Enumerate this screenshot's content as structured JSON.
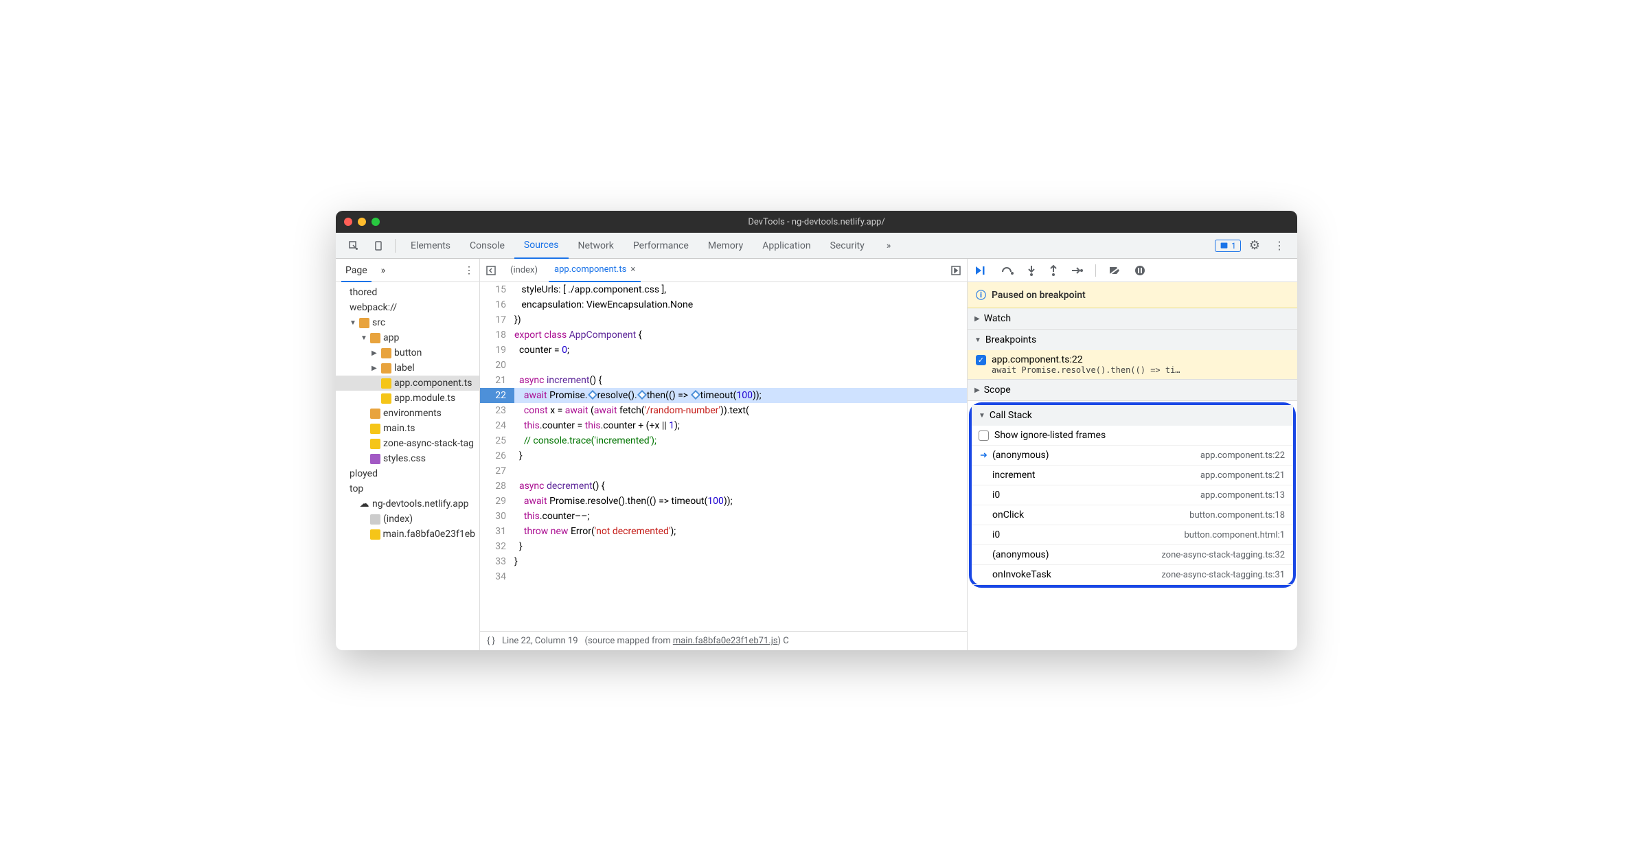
{
  "title": "DevTools - ng-devtools.netlify.app/",
  "topTabs": [
    "Elements",
    "Console",
    "Sources",
    "Network",
    "Performance",
    "Memory",
    "Application",
    "Security"
  ],
  "topTabActive": "Sources",
  "overflowChevrons": "»",
  "issueCount": "1",
  "navTab": "Page",
  "tree": [
    {
      "label": "thored",
      "indent": 0,
      "kind": "plain"
    },
    {
      "label": "webpack://",
      "indent": 0,
      "kind": "plain"
    },
    {
      "label": "src",
      "indent": 1,
      "kind": "folder",
      "open": true
    },
    {
      "label": "app",
      "indent": 2,
      "kind": "folder",
      "open": true
    },
    {
      "label": "button",
      "indent": 3,
      "kind": "folder",
      "arrow": true
    },
    {
      "label": "label",
      "indent": 3,
      "kind": "folder",
      "arrow": true
    },
    {
      "label": "app.component.ts",
      "indent": 4,
      "kind": "file-y",
      "sel": true
    },
    {
      "label": "app.module.ts",
      "indent": 4,
      "kind": "file-y"
    },
    {
      "label": "environments",
      "indent": 2,
      "kind": "folder"
    },
    {
      "label": "main.ts",
      "indent": 2,
      "kind": "file-y"
    },
    {
      "label": "zone-async-stack-tag",
      "indent": 2,
      "kind": "file-y"
    },
    {
      "label": "styles.css",
      "indent": 2,
      "kind": "file-p"
    },
    {
      "label": "ployed",
      "indent": 0,
      "kind": "plain"
    },
    {
      "label": "top",
      "indent": 0,
      "kind": "plain"
    },
    {
      "label": "ng-devtools.netlify.app",
      "indent": 1,
      "kind": "cloud"
    },
    {
      "label": "(index)",
      "indent": 2,
      "kind": "file-g"
    },
    {
      "label": "main.fa8bfa0e23f1eb",
      "indent": 2,
      "kind": "file-y"
    }
  ],
  "editorTabs": [
    {
      "label": "(index)",
      "active": false
    },
    {
      "label": "app.component.ts",
      "active": true
    }
  ],
  "code": {
    "start": 15,
    "lines": [
      "   styleUrls: [ ./app.component.css ],",
      "   encapsulation: ViewEncapsulation.None",
      "})",
      "export class AppComponent {",
      "  counter = 0;",
      "",
      "  async increment() {",
      "    await Promise.resolve().then(() => timeout(100));",
      "    const x = await (await fetch('/random-number')).text(",
      "    this.counter = this.counter + (+x || 1);",
      "    // console.trace('incremented');",
      "  }",
      "",
      "  async decrement() {",
      "    await Promise.resolve().then(() => timeout(100));",
      "    this.counter––;",
      "    throw new Error('not decremented');",
      "  }",
      "}",
      ""
    ],
    "highlight": 22
  },
  "statusLine": "Line 22, Column 19",
  "statusMapped": "main.fa8bfa0e23f1eb71.js",
  "paused": "Paused on breakpoint",
  "sections": {
    "watch": "Watch",
    "breakpoints": "Breakpoints",
    "scope": "Scope",
    "callstack": "Call Stack"
  },
  "breakpoint": {
    "file": "app.component.ts:22",
    "code": "await Promise.resolve().then(() => ti…"
  },
  "showIgnore": "Show ignore-listed frames",
  "callstack": [
    {
      "fn": "(anonymous)",
      "loc": "app.component.ts:22",
      "active": true
    },
    {
      "fn": "increment",
      "loc": "app.component.ts:21"
    },
    {
      "fn": "i0",
      "loc": "app.component.ts:13"
    },
    {
      "fn": "onClick",
      "loc": "button.component.ts:18"
    },
    {
      "fn": "i0",
      "loc": "button.component.html:1"
    },
    {
      "fn": "(anonymous)",
      "loc": "zone-async-stack-tagging.ts:32"
    },
    {
      "fn": "onInvokeTask",
      "loc": "zone-async-stack-tagging.ts:31"
    }
  ]
}
